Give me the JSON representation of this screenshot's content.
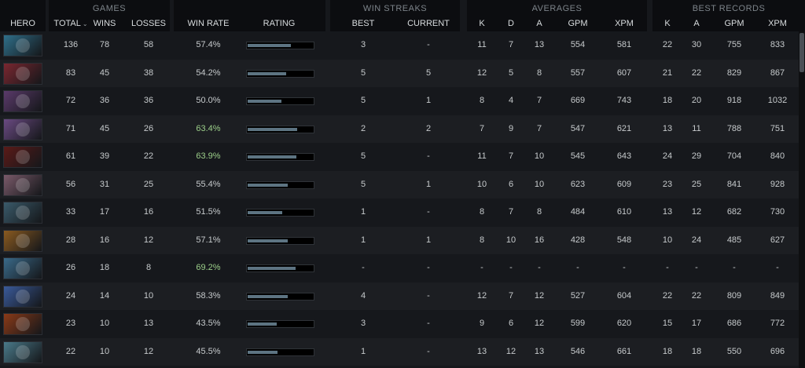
{
  "groups": {
    "hero": "",
    "games": "GAMES",
    "winrate": "",
    "winstreaks": "WIN STREAKS",
    "averages": "AVERAGES",
    "best": "BEST RECORDS"
  },
  "headers": {
    "hero": "HERO",
    "total": "TOTAL",
    "wins": "WINS",
    "losses": "LOSSES",
    "winrate": "WIN RATE",
    "rating": "RATING",
    "best": "BEST",
    "current": "CURRENT",
    "avg_k": "K",
    "avg_d": "D",
    "avg_a": "A",
    "avg_gpm": "GPM",
    "avg_xpm": "XPM",
    "best_k": "K",
    "best_a": "A",
    "best_gpm": "GPM",
    "best_xpm": "XPM"
  },
  "sort": {
    "column": "total",
    "direction": "desc",
    "icon": "chevron-down-icon"
  },
  "colors": {
    "high_winrate": "#9ccf8a",
    "rating_bar": "#5d7482",
    "background": "#16181c"
  },
  "rows": [
    {
      "portrait_color": "#2f6f8a",
      "total": "136",
      "wins": "78",
      "losses": "58",
      "winrate": "57.4%",
      "rating": 0.65,
      "streak_best": "3",
      "streak_current": "-",
      "avg_k": "11",
      "avg_d": "7",
      "avg_a": "13",
      "avg_gpm": "554",
      "avg_xpm": "581",
      "best_k": "22",
      "best_a": "30",
      "best_gpm": "755",
      "best_xpm": "833",
      "green": false
    },
    {
      "portrait_color": "#7a2730",
      "total": "83",
      "wins": "45",
      "losses": "38",
      "winrate": "54.2%",
      "rating": 0.58,
      "streak_best": "5",
      "streak_current": "5",
      "avg_k": "12",
      "avg_d": "5",
      "avg_a": "8",
      "avg_gpm": "557",
      "avg_xpm": "607",
      "best_k": "21",
      "best_a": "22",
      "best_gpm": "829",
      "best_xpm": "867",
      "green": false
    },
    {
      "portrait_color": "#5a3a6a",
      "total": "72",
      "wins": "36",
      "losses": "36",
      "winrate": "50.0%",
      "rating": 0.5,
      "streak_best": "5",
      "streak_current": "1",
      "avg_k": "8",
      "avg_d": "4",
      "avg_a": "7",
      "avg_gpm": "669",
      "avg_xpm": "743",
      "best_k": "18",
      "best_a": "20",
      "best_gpm": "918",
      "best_xpm": "1032",
      "green": false
    },
    {
      "portrait_color": "#6a4a82",
      "total": "71",
      "wins": "45",
      "losses": "26",
      "winrate": "63.4%",
      "rating": 0.74,
      "streak_best": "2",
      "streak_current": "2",
      "avg_k": "7",
      "avg_d": "9",
      "avg_a": "7",
      "avg_gpm": "547",
      "avg_xpm": "621",
      "best_k": "13",
      "best_a": "11",
      "best_gpm": "788",
      "best_xpm": "751",
      "green": true
    },
    {
      "portrait_color": "#5a1a18",
      "total": "61",
      "wins": "39",
      "losses": "22",
      "winrate": "63.9%",
      "rating": 0.73,
      "streak_best": "5",
      "streak_current": "-",
      "avg_k": "11",
      "avg_d": "7",
      "avg_a": "10",
      "avg_gpm": "545",
      "avg_xpm": "643",
      "best_k": "24",
      "best_a": "29",
      "best_gpm": "704",
      "best_xpm": "840",
      "green": true
    },
    {
      "portrait_color": "#7a5a6a",
      "total": "56",
      "wins": "31",
      "losses": "25",
      "winrate": "55.4%",
      "rating": 0.6,
      "streak_best": "5",
      "streak_current": "1",
      "avg_k": "10",
      "avg_d": "6",
      "avg_a": "10",
      "avg_gpm": "623",
      "avg_xpm": "609",
      "best_k": "23",
      "best_a": "25",
      "best_gpm": "841",
      "best_xpm": "928",
      "green": false
    },
    {
      "portrait_color": "#3a5a6a",
      "total": "33",
      "wins": "17",
      "losses": "16",
      "winrate": "51.5%",
      "rating": 0.52,
      "streak_best": "1",
      "streak_current": "-",
      "avg_k": "8",
      "avg_d": "7",
      "avg_a": "8",
      "avg_gpm": "484",
      "avg_xpm": "610",
      "best_k": "13",
      "best_a": "12",
      "best_gpm": "682",
      "best_xpm": "730",
      "green": false
    },
    {
      "portrait_color": "#8a5a20",
      "total": "28",
      "wins": "16",
      "losses": "12",
      "winrate": "57.1%",
      "rating": 0.6,
      "streak_best": "1",
      "streak_current": "1",
      "avg_k": "8",
      "avg_d": "10",
      "avg_a": "16",
      "avg_gpm": "428",
      "avg_xpm": "548",
      "best_k": "10",
      "best_a": "24",
      "best_gpm": "485",
      "best_xpm": "627",
      "green": false
    },
    {
      "portrait_color": "#3a6a8a",
      "total": "26",
      "wins": "18",
      "losses": "8",
      "winrate": "69.2%",
      "rating": 0.72,
      "streak_best": "-",
      "streak_current": "-",
      "avg_k": "-",
      "avg_d": "-",
      "avg_a": "-",
      "avg_gpm": "-",
      "avg_xpm": "-",
      "best_k": "-",
      "best_a": "-",
      "best_gpm": "-",
      "best_xpm": "-",
      "green": true
    },
    {
      "portrait_color": "#3a5a9a",
      "total": "24",
      "wins": "14",
      "losses": "10",
      "winrate": "58.3%",
      "rating": 0.6,
      "streak_best": "4",
      "streak_current": "-",
      "avg_k": "12",
      "avg_d": "7",
      "avg_a": "12",
      "avg_gpm": "527",
      "avg_xpm": "604",
      "best_k": "22",
      "best_a": "22",
      "best_gpm": "809",
      "best_xpm": "849",
      "green": false
    },
    {
      "portrait_color": "#8a3a18",
      "total": "23",
      "wins": "10",
      "losses": "13",
      "winrate": "43.5%",
      "rating": 0.43,
      "streak_best": "3",
      "streak_current": "-",
      "avg_k": "9",
      "avg_d": "6",
      "avg_a": "12",
      "avg_gpm": "599",
      "avg_xpm": "620",
      "best_k": "15",
      "best_a": "17",
      "best_gpm": "686",
      "best_xpm": "772",
      "green": false
    },
    {
      "portrait_color": "#4a7a8a",
      "total": "22",
      "wins": "10",
      "losses": "12",
      "winrate": "45.5%",
      "rating": 0.45,
      "streak_best": "1",
      "streak_current": "-",
      "avg_k": "13",
      "avg_d": "12",
      "avg_a": "13",
      "avg_gpm": "546",
      "avg_xpm": "661",
      "best_k": "18",
      "best_a": "18",
      "best_gpm": "550",
      "best_xpm": "696",
      "green": false
    }
  ]
}
